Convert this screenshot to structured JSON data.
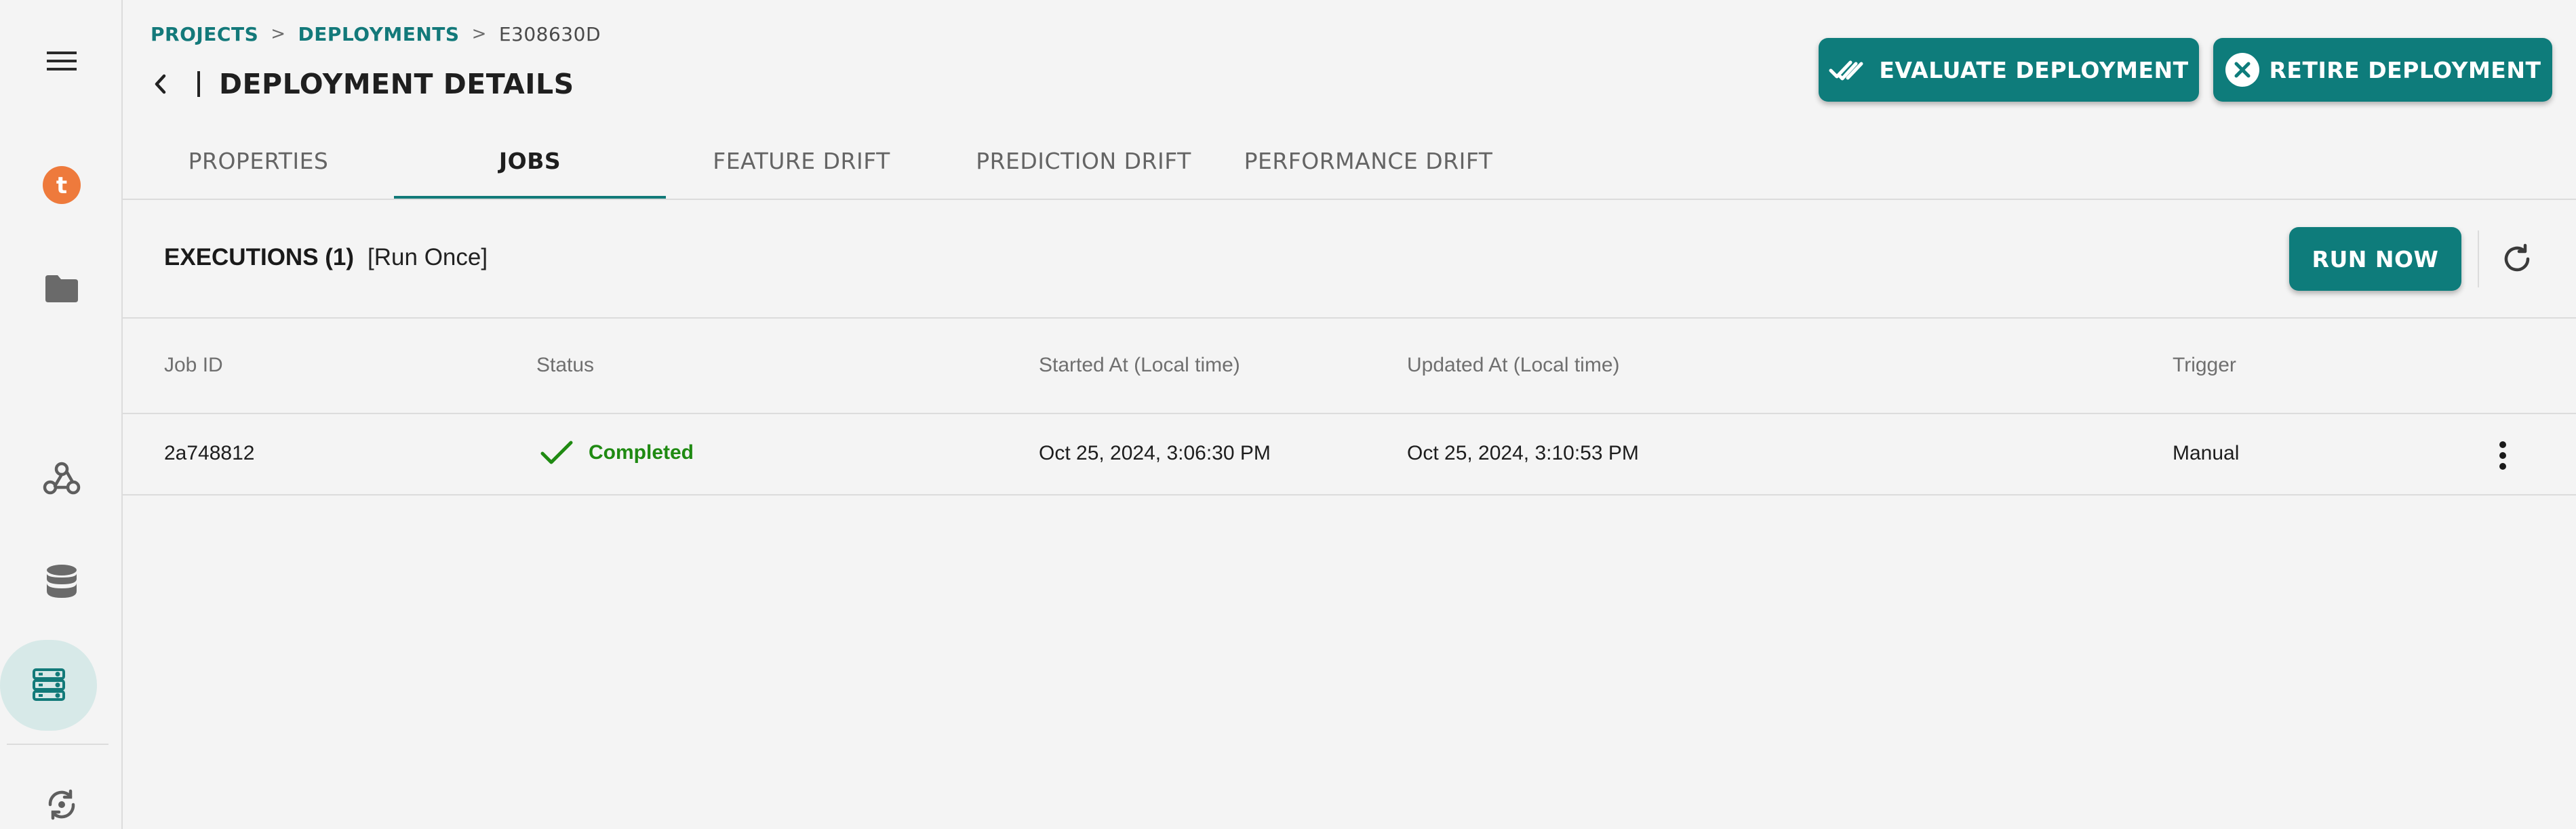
{
  "sidebar": {
    "icons": [
      "menu-icon",
      "brand-logo-icon",
      "folder-icon",
      "webhook-icon",
      "database-icon",
      "server-icon",
      "recycle-icon"
    ],
    "active_item": "server-icon",
    "brand_letter": "t",
    "brand_color": "#ee7a3c"
  },
  "breadcrumb": {
    "items": [
      "PROJECTS",
      "DEPLOYMENTS",
      "E308630D"
    ],
    "separator": ">"
  },
  "header": {
    "title": "DEPLOYMENT DETAILS",
    "evaluate_label": "EVALUATE DEPLOYMENT",
    "retire_label": "RETIRE DEPLOYMENT"
  },
  "tabs": [
    {
      "label": "PROPERTIES",
      "active": false
    },
    {
      "label": "JOBS",
      "active": true
    },
    {
      "label": "FEATURE DRIFT",
      "active": false
    },
    {
      "label": "PREDICTION DRIFT",
      "active": false
    },
    {
      "label": "PERFORMANCE DRIFT",
      "active": false
    }
  ],
  "executions": {
    "title": "EXECUTIONS (1)",
    "mode": "[Run Once]",
    "run_now_label": "RUN NOW"
  },
  "table": {
    "columns": [
      "Job ID",
      "Status",
      "Started At (Local time)",
      "Updated At (Local time)",
      "Trigger"
    ],
    "rows": [
      {
        "job_id": "2a748812",
        "status": "Completed",
        "started_at": "Oct 25, 2024, 3:06:30 PM",
        "updated_at": "Oct 25, 2024, 3:10:53 PM",
        "trigger": "Manual"
      }
    ]
  },
  "colors": {
    "accent": "#0e7c7b",
    "success": "#1f8a12",
    "link": "#13797a"
  }
}
